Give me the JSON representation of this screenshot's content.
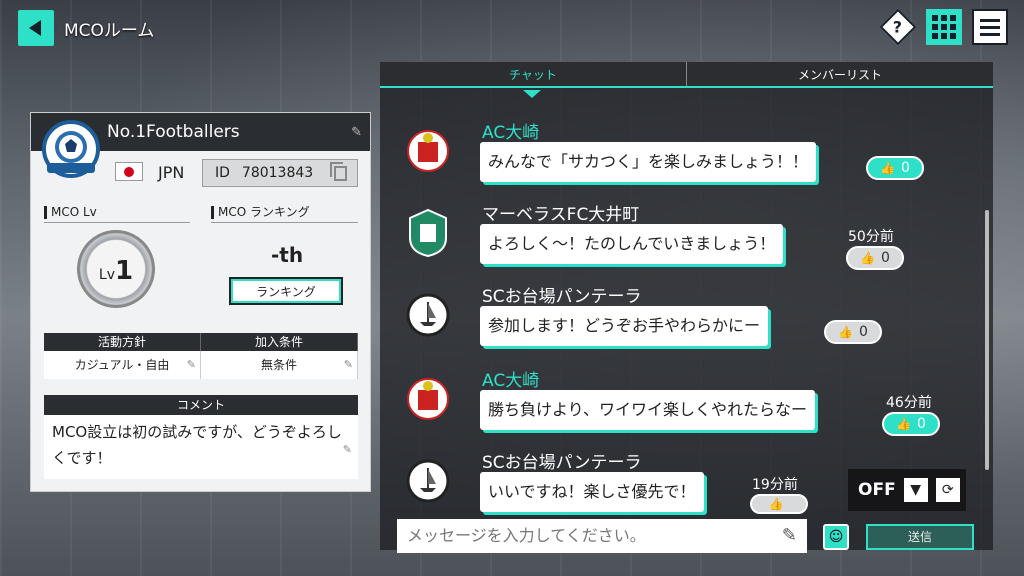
{
  "header": {
    "title": "MCOルーム"
  },
  "club": {
    "name": "No.1Footballers",
    "country": "JPN",
    "id_label": "ID",
    "id_value": "78013843",
    "mco_lv_label": "MCO Lv",
    "lv_prefix": "Lv",
    "lv_value": "1",
    "mco_rank_label": "MCO ランキング",
    "rank_value": "-th",
    "ranking_button": "ランキング",
    "policy_header": "活動方針",
    "join_header": "加入条件",
    "policy_value": "カジュアル・自由",
    "join_value": "無条件",
    "comment_header": "コメント",
    "comment_text": "MCO設立は初の試みですが、どうぞよろしくです！"
  },
  "chat": {
    "tabs": [
      {
        "label": "チャット",
        "active": true
      },
      {
        "label": "メンバーリスト",
        "active": false
      }
    ],
    "messages": [
      {
        "sender": "AC大崎",
        "text": "みんなで「サカつく」を楽しみましょう！！",
        "likes": "0",
        "time": ""
      },
      {
        "sender": "マーベラスFC大井町",
        "text": "よろしく～！たのしんでいきましょう！",
        "likes": "0",
        "time": "50分前"
      },
      {
        "sender": "SCお台場パンテーラ",
        "text": "参加します！どうぞお手やわらかにー",
        "likes": "0",
        "time": ""
      },
      {
        "sender": "AC大崎",
        "text": "勝ち負けより、ワイワイ楽しくやれたらなー",
        "likes": "0",
        "time": "46分前"
      },
      {
        "sender": "SCお台場パンテーラ",
        "text": "いいですね！楽しさ優先で！",
        "likes": "",
        "time": "19分前"
      }
    ],
    "filter_label": "OFF",
    "input_placeholder": "メッセージを入力してください。",
    "send_label": "送信"
  },
  "colors": {
    "accent": "#2fe0c8",
    "dark": "#2a2d31"
  }
}
